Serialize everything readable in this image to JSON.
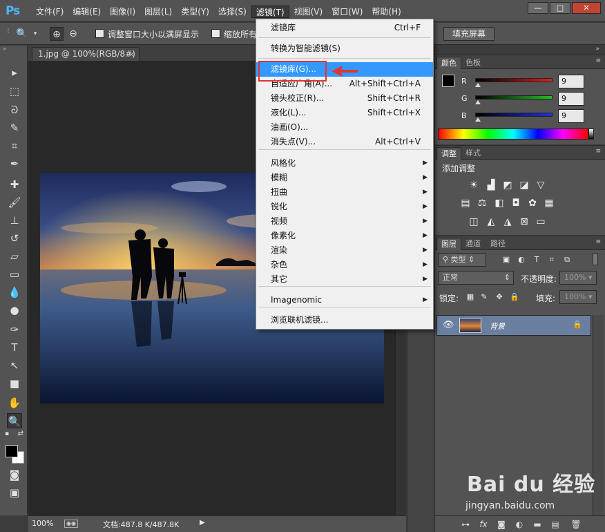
{
  "app": {
    "logo": "Ps"
  },
  "menubar": {
    "items": [
      "文件(F)",
      "编辑(E)",
      "图像(I)",
      "图层(L)",
      "类型(Y)",
      "选择(S)",
      "滤镜(T)",
      "视图(V)",
      "窗口(W)",
      "帮助(H)"
    ],
    "active_index": 6,
    "window_buttons": [
      "—",
      "□",
      "✕"
    ]
  },
  "options": {
    "checkbox1_label": "调整窗口大小以满屏显示",
    "checkbox2_label": "缩放所有",
    "fill_screen_label": "填充屏幕"
  },
  "document": {
    "tab_title": "1.jpg @ 100%(RGB/8#)",
    "tab_close": "×",
    "zoom": "100%",
    "doc_size": "文档:487.8 K/487.8K"
  },
  "filter_menu": {
    "items": [
      {
        "label": "滤镜库",
        "shortcut": "Ctrl+F"
      },
      {
        "label": "转换为智能滤镜(S)"
      },
      {
        "label": "滤镜库(G)...",
        "highlighted": true
      },
      {
        "label": "自适应广角(A)...",
        "shortcut": "Alt+Shift+Ctrl+A"
      },
      {
        "label": "镜头校正(R)...",
        "shortcut": "Shift+Ctrl+R"
      },
      {
        "label": "液化(L)...",
        "shortcut": "Shift+Ctrl+X"
      },
      {
        "label": "油画(O)..."
      },
      {
        "label": "消失点(V)...",
        "shortcut": "Alt+Ctrl+V"
      },
      {
        "label": "风格化",
        "submenu": true
      },
      {
        "label": "模糊",
        "submenu": true
      },
      {
        "label": "扭曲",
        "submenu": true
      },
      {
        "label": "锐化",
        "submenu": true
      },
      {
        "label": "视频",
        "submenu": true
      },
      {
        "label": "像素化",
        "submenu": true
      },
      {
        "label": "渲染",
        "submenu": true
      },
      {
        "label": "杂色",
        "submenu": true
      },
      {
        "label": "其它",
        "submenu": true
      },
      {
        "label": "Imagenomic",
        "submenu": true
      },
      {
        "label": "浏览联机滤镜..."
      }
    ]
  },
  "color_panel": {
    "tabs": [
      "颜色",
      "色板"
    ],
    "channels": [
      {
        "letter": "R",
        "value": "9",
        "color": "#e02020"
      },
      {
        "letter": "G",
        "value": "9",
        "color": "#20c020"
      },
      {
        "letter": "B",
        "value": "9",
        "color": "#2030e0"
      }
    ]
  },
  "adjust_panel": {
    "tabs": [
      "调整",
      "样式"
    ],
    "title": "添加调整"
  },
  "layers_panel": {
    "tabs": [
      "图层",
      "通道",
      "路径"
    ],
    "filter_kind": "类型",
    "blend_mode": "正常",
    "opacity_label": "不透明度:",
    "opacity_value": "100%",
    "lock_label": "锁定:",
    "fill_label": "填充:",
    "fill_value": "100%",
    "layer_name": "背景"
  },
  "watermark": {
    "brand": "Bai du 经验",
    "url": "jingyan.baidu.com"
  },
  "colors": {
    "highlight": "#3399ff",
    "annotation_red": "#e53333"
  }
}
